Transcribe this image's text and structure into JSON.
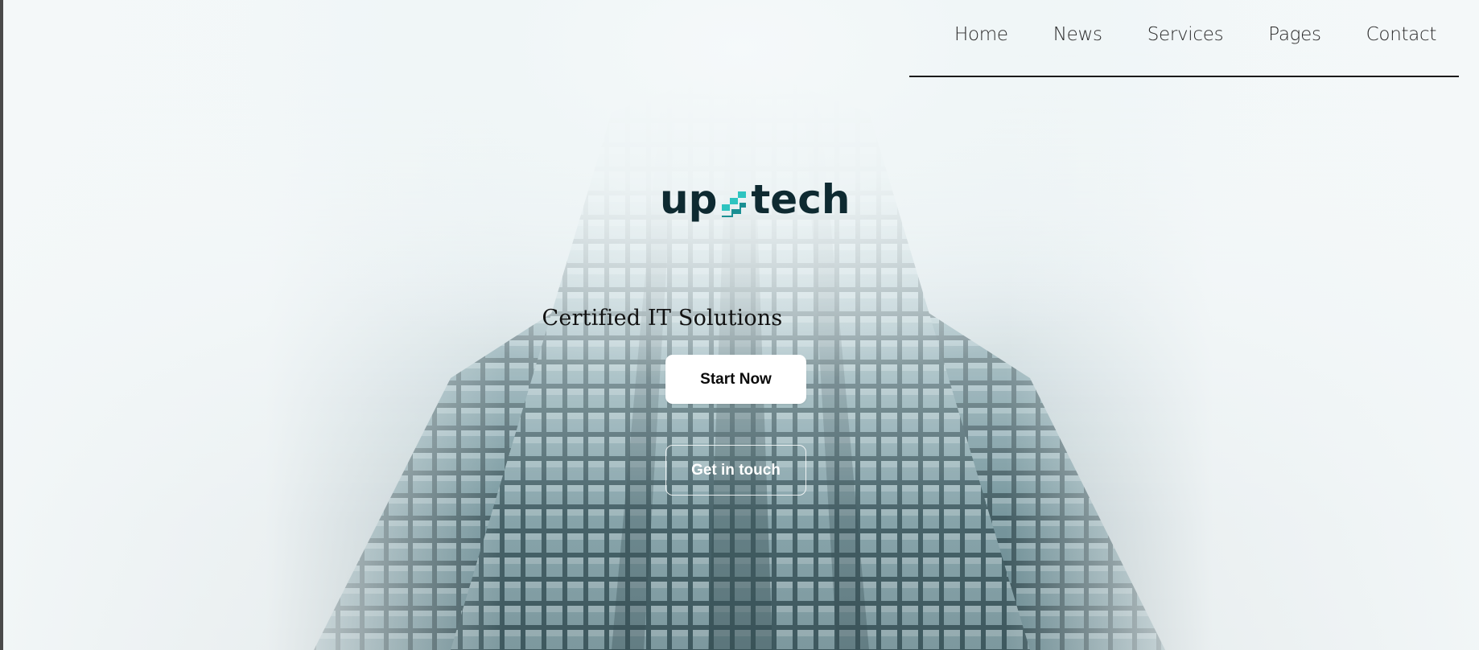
{
  "nav": {
    "items": [
      {
        "label": "Home"
      },
      {
        "label": "News"
      },
      {
        "label": "Services"
      },
      {
        "label": "Pages"
      },
      {
        "label": "Contact"
      }
    ]
  },
  "logo": {
    "text_left": "up",
    "text_right": "tech",
    "mark_icon": "upstairs-logo-mark-icon"
  },
  "hero": {
    "tagline": "Certified IT Solutions",
    "primary_button": "Start Now",
    "secondary_button": "Get in touch"
  },
  "colors": {
    "logo_text": "#0e2a31",
    "logo_accent": "#2ec4c0",
    "nav_text": "#2a2a2a",
    "button_primary_bg": "#ffffff"
  }
}
